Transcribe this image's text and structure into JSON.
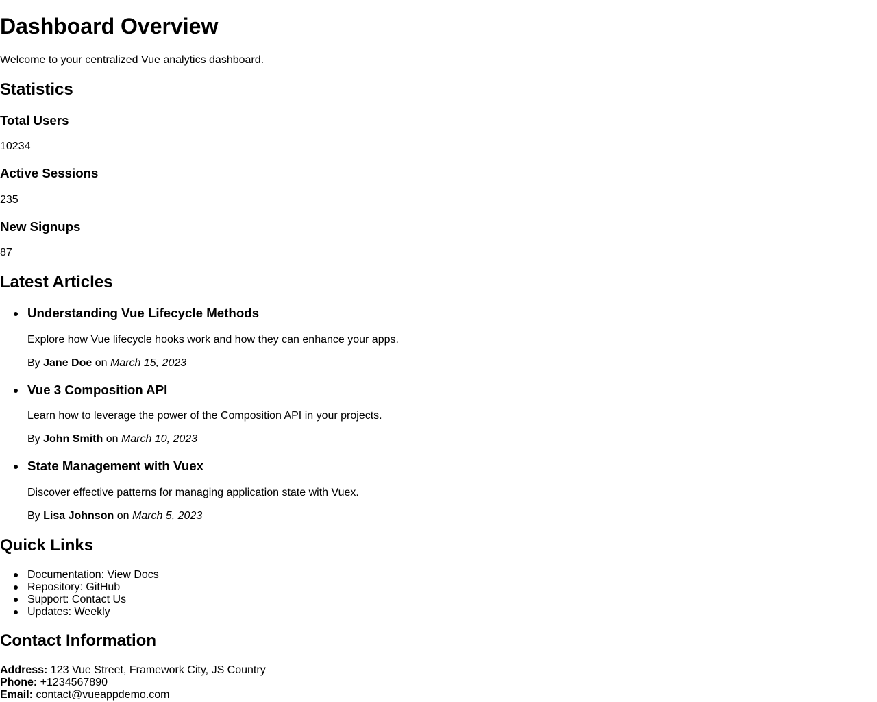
{
  "page": {
    "title": "Dashboard Overview",
    "welcome": "Welcome to your centralized Vue analytics dashboard."
  },
  "statistics": {
    "heading": "Statistics",
    "items": [
      {
        "label": "Total Users",
        "value": "10234"
      },
      {
        "label": "Active Sessions",
        "value": "235"
      },
      {
        "label": "New Signups",
        "value": "87"
      }
    ]
  },
  "articles": {
    "heading": "Latest Articles",
    "by_prefix": "By",
    "on_word": "on",
    "items": [
      {
        "title": "Understanding Vue Lifecycle Methods",
        "summary": "Explore how Vue lifecycle hooks work and how they can enhance your apps.",
        "author": "Jane Doe",
        "date": "March 15, 2023"
      },
      {
        "title": "Vue 3 Composition API",
        "summary": "Learn how to leverage the power of the Composition API in your projects.",
        "author": "John Smith",
        "date": "March 10, 2023"
      },
      {
        "title": "State Management with Vuex",
        "summary": "Discover effective patterns for managing application state with Vuex.",
        "author": "Lisa Johnson",
        "date": "March 5, 2023"
      }
    ]
  },
  "quick_links": {
    "heading": "Quick Links",
    "items": [
      "Documentation: View Docs",
      "Repository: GitHub",
      "Support: Contact Us",
      "Updates: Weekly"
    ]
  },
  "contact": {
    "heading": "Contact Information",
    "address_label": "Address:",
    "address": "123 Vue Street, Framework City, JS Country",
    "phone_label": "Phone:",
    "phone": "+1234567890",
    "email_label": "Email:",
    "email": "contact@vueappdemo.com"
  }
}
